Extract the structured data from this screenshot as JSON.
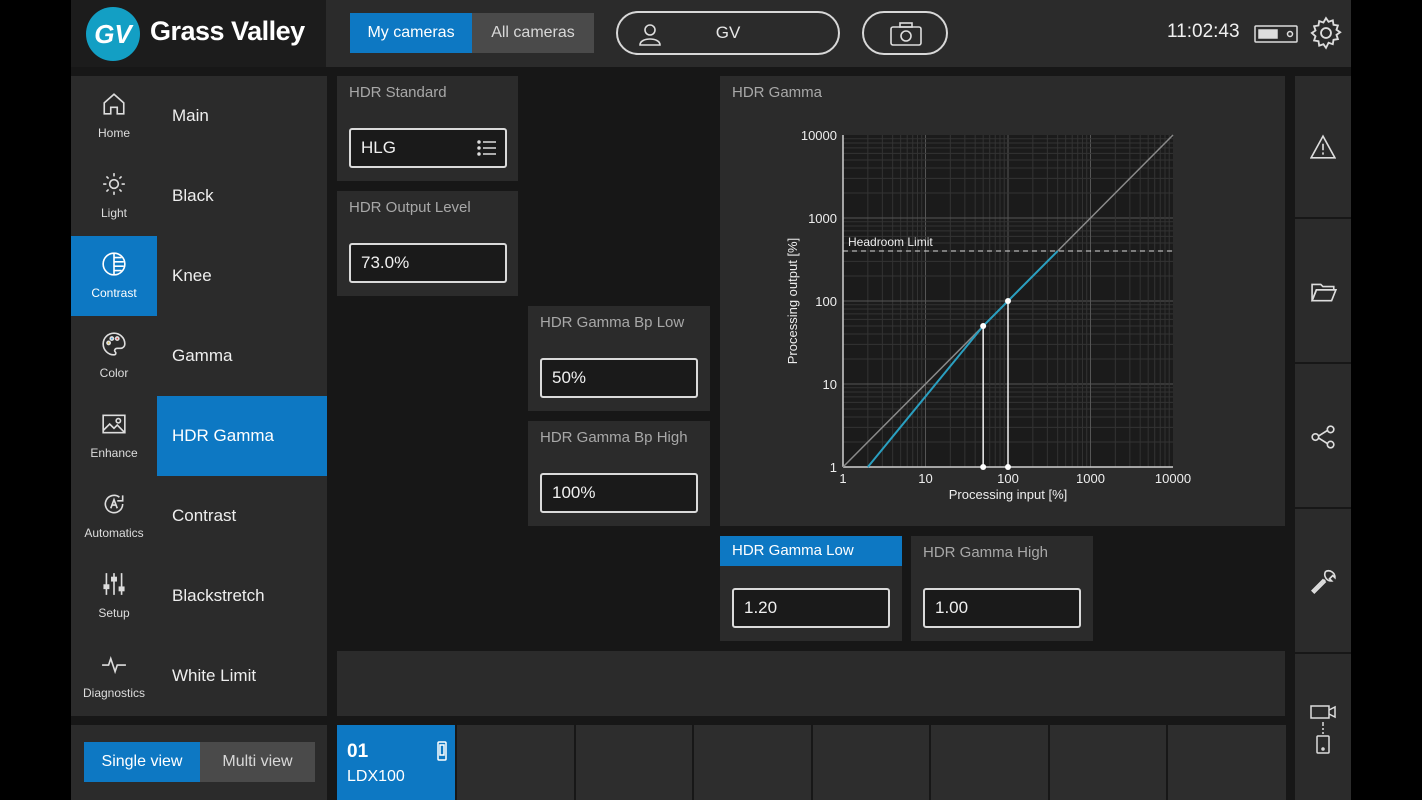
{
  "brand": {
    "logo_mark": "GV",
    "name": "Grass Valley"
  },
  "header": {
    "camera_tabs": [
      {
        "label": "My cameras",
        "active": true
      },
      {
        "label": "All cameras",
        "active": false
      }
    ],
    "user_name": "GV",
    "time": "11:02:43",
    "icons": [
      "user-icon",
      "camera-icon",
      "battery-icon",
      "gear-icon"
    ]
  },
  "sidebar": {
    "items": [
      {
        "label": "Home",
        "icon": "home-icon",
        "active": false
      },
      {
        "label": "Light",
        "icon": "sun-icon",
        "active": false
      },
      {
        "label": "Contrast",
        "icon": "contrast-icon",
        "active": true
      },
      {
        "label": "Color",
        "icon": "palette-icon",
        "active": false
      },
      {
        "label": "Enhance",
        "icon": "image-icon",
        "active": false
      },
      {
        "label": "Automatics",
        "icon": "auto-icon",
        "active": false
      },
      {
        "label": "Setup",
        "icon": "sliders-icon",
        "active": false
      },
      {
        "label": "Diagnostics",
        "icon": "pulse-icon",
        "active": false
      }
    ]
  },
  "submenu": {
    "items": [
      {
        "label": "Main",
        "active": false
      },
      {
        "label": "Black",
        "active": false
      },
      {
        "label": "Knee",
        "active": false
      },
      {
        "label": "Gamma",
        "active": false
      },
      {
        "label": "HDR Gamma",
        "active": true
      },
      {
        "label": "Contrast",
        "active": false
      },
      {
        "label": "Blackstretch",
        "active": false
      },
      {
        "label": "White Limit",
        "active": false
      }
    ]
  },
  "controls": {
    "hdr_standard": {
      "label": "HDR Standard",
      "value": "HLG",
      "icon": "list-icon"
    },
    "hdr_output_level": {
      "label": "HDR Output Level",
      "value": "73.0%"
    },
    "bp_low": {
      "label": "HDR Gamma Bp Low",
      "value": "50%"
    },
    "bp_high": {
      "label": "HDR Gamma Bp High",
      "value": "100%"
    },
    "gamma_low": {
      "label": "HDR Gamma Low",
      "value": "1.20",
      "highlighted": true
    },
    "gamma_high": {
      "label": "HDR Gamma High",
      "value": "1.00"
    }
  },
  "chart_panel": {
    "title": "HDR Gamma"
  },
  "chart_data": {
    "type": "line",
    "xlabel": "Processing input [%]",
    "ylabel": "Processing output [%]",
    "xscale": "log",
    "yscale": "log",
    "xlim": [
      1,
      10000
    ],
    "ylim": [
      1,
      10000
    ],
    "x_ticks": [
      "1",
      "10",
      "100",
      "1000",
      "10000"
    ],
    "y_ticks": [
      "1",
      "10",
      "100",
      "1000",
      "10000"
    ],
    "grid": true,
    "annotations": [
      {
        "text": "Headroom Limit",
        "y": 400
      }
    ],
    "series": [
      {
        "style": "reference",
        "color": "#8a8a8a",
        "x": [
          1,
          10000
        ],
        "y": [
          1,
          10000
        ]
      },
      {
        "style": "curve",
        "color": "#2a9fc0",
        "x": [
          2,
          50,
          100,
          400
        ],
        "y": [
          1,
          50,
          100,
          400
        ]
      }
    ],
    "breakpoints": [
      {
        "x": 50,
        "y": 50
      },
      {
        "x": 100,
        "y": 100
      }
    ]
  },
  "rail": {
    "icons": [
      "warning-icon",
      "folder-icon",
      "share-icon",
      "wrench-icon",
      "camera-remote-icon"
    ]
  },
  "view_toggle": [
    {
      "label": "Single view",
      "active": true
    },
    {
      "label": "Multi view",
      "active": false
    }
  ],
  "camera_strip": {
    "active_camera": {
      "number": "01",
      "model": "LDX100",
      "icon": "mobile-icon"
    },
    "empty_slots": 7
  },
  "colors": {
    "accent": "#0d78c3",
    "curve": "#2a9fc0",
    "panel": "#2b2b2b",
    "background": "#171717"
  }
}
